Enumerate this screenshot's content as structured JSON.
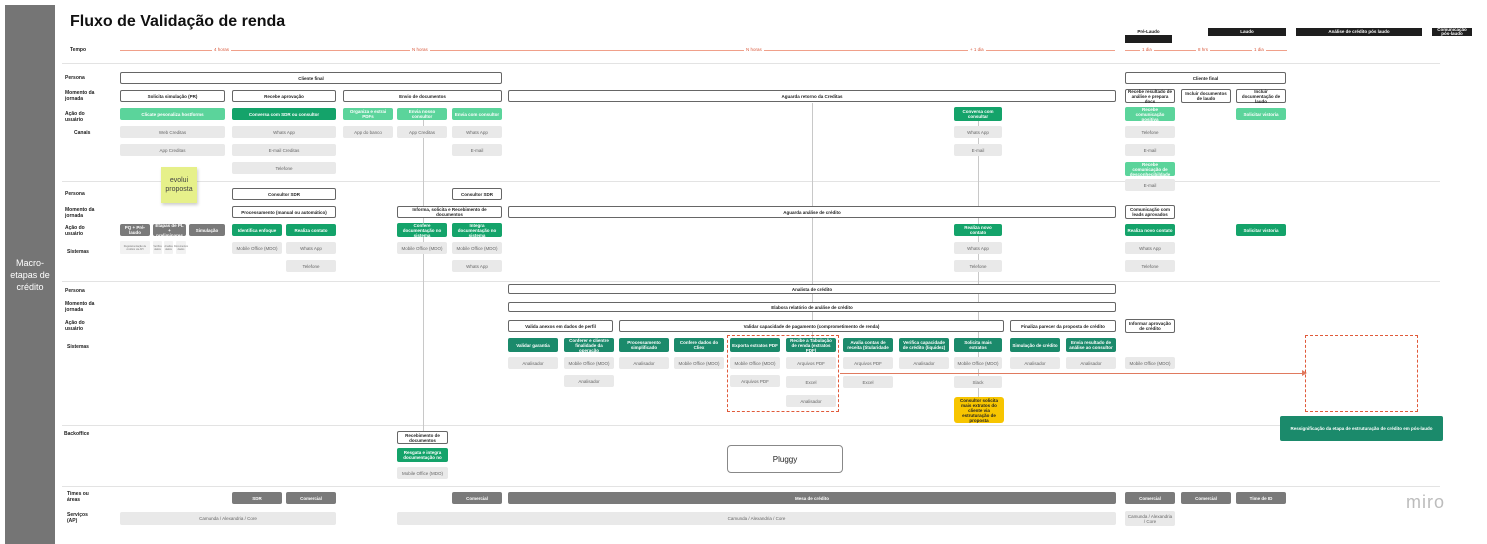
{
  "title": "Fluxo de Validação de renda",
  "side_label": "Macro-etapas de crédito",
  "brand": "miro",
  "labels": {
    "tempo": "Tempo",
    "persona": "Persona",
    "momento": "Momento da jornada",
    "acao": "Ação do usuário",
    "canais": "Canais",
    "sistemas": "Sistemas",
    "backoffice": "Backoffice",
    "times": "Times ou áreas",
    "servicos": "Serviços (AP)"
  },
  "phase_headers": {
    "pre_laudo": "Pré-Laudo",
    "laudo": "Laudo",
    "analise_pos_laudo": "Análise de crédito pós laudo",
    "comunicacao": "Comunicação pós-laudo"
  },
  "timeline": {
    "t1": "4 horas",
    "t2": "N horas",
    "t3": "N horas",
    "t4": "+ 1 dia",
    "t5": "1 dia",
    "t6": "8 hrs",
    "t7": "1 dia"
  },
  "sticky_note": "evolui proposta",
  "pluggy": "Pluggy",
  "section1": {
    "persona": "Cliente final",
    "persona_right": "Cliente final",
    "momentos": [
      "Solicita simulação (PR)",
      "Recebe aprovação",
      "Envio de documentos",
      "Aguarda retorno da Creditas",
      "Recebe resultado de análise e prepara docs",
      "Incluir documentos de laudo",
      "Incluir documentação de laudo"
    ],
    "acoes": [
      "Clicate pesonaliza hostforms",
      "Conversa com SDR ou consultor",
      "Organiza e extrai PDFs",
      "Envia nosso consultor",
      "Envia com consultor",
      "Conversa com consultar",
      "Recebe comunicação positiva",
      "Solicitar vistoria",
      "Recebe comunicação de desconhecibildade"
    ],
    "canais": [
      "Web Creditas",
      "App Creditas",
      "Whats App",
      "E-mail Creditas",
      "Telefone",
      "App do banco",
      "App Creditas",
      "Whats App",
      "E-mail",
      "Whats App",
      "E-mail",
      "Telefone",
      "E-mail",
      "E-mail"
    ]
  },
  "section2": {
    "personas": [
      "Consultor SDR",
      "Consultor SDR"
    ],
    "momentos": [
      "Processamento (manual ou automático)",
      "Informa, solicita e Recebimento de documentos",
      "Aguarda análise de crédito",
      "Comunicação com leads aprovados"
    ],
    "acoes": [
      "PQ + Pré-laudo",
      "Etapas de PL + preliminares",
      "Simulação",
      "Identifica enfoque",
      "Realiza contato",
      "Confere documentação no sistema",
      "Integra documentação no sistema",
      "Realiza novo contato",
      "Realiza novo contato",
      "Solicitar vistoria"
    ],
    "tiny": [
      "Regulamentação de créditos via API",
      "Verifica dados",
      "Analisa dados",
      "Documentos dados"
    ],
    "sistemas": [
      "Mobile Office (MDO)",
      "Whats App",
      "Telefone",
      "Mobile Office (MDO)",
      "Mobile Office (MDO)",
      "Whats App",
      "Whats App",
      "Telefone",
      "Whats App",
      "Telefone"
    ]
  },
  "section3": {
    "persona": "Analista de crédito",
    "momento": "Elabora relatório de análise de crédito",
    "acoes": [
      "Valida anexos em dados de perfil",
      "Validar capacidade de pagamento (comprometimento de renda)",
      "Finaliza parecer da proposta de crédito",
      "Informar aprovação de crédito"
    ],
    "sistemas_top": [
      "Validar garantia",
      "Conferer e clientre finalidade da operação",
      "Processamento simplificado",
      "Confere dados do Cliex",
      "Exporta extratos PDF",
      "Recibe a Tabulação de renda (extratos PDF)",
      "Avalia contas de receita (titularidade",
      "Verifica capacidade de crédito (liquidez)",
      "Solicita mais extratos",
      "Simulação de crédito",
      "Envia resultado de análise ao consultor"
    ],
    "sistemas": [
      "Analisador",
      "Mobile Office (MDO)",
      "Analisador",
      "Analisador",
      "Mobile Office (MDO)",
      "Mobile Office (MDO)",
      "Arquivos PDF",
      "Arquivos PDF",
      "Excel",
      "Analisador",
      "Arquivos PDF",
      "Excel",
      "Analisador",
      "Mobile Office (MDO)",
      "Slack",
      "Analisador",
      "Analisador",
      "Mobile Office (MDO)"
    ],
    "yellow": "Consultor solicita mais extratos do cliente via estruturação de proposta",
    "cta": "Ressignificação da etapa de estruturação de crédito em pós-laudo"
  },
  "backoffice": {
    "box": "Recebimento de documentos",
    "green": "Resgata e integra documentação no",
    "system": "Mobile Office (MDO)"
  },
  "times": [
    "SDR",
    "Comercial",
    "Comercial",
    "Mesa de crédito",
    "Comercial",
    "Comercial",
    "Time de ID"
  ],
  "servicos": [
    "Camunda / Alexandria / Core",
    "Camunda / Alexandria / Core",
    "Camunda / Alexandria / Core"
  ]
}
